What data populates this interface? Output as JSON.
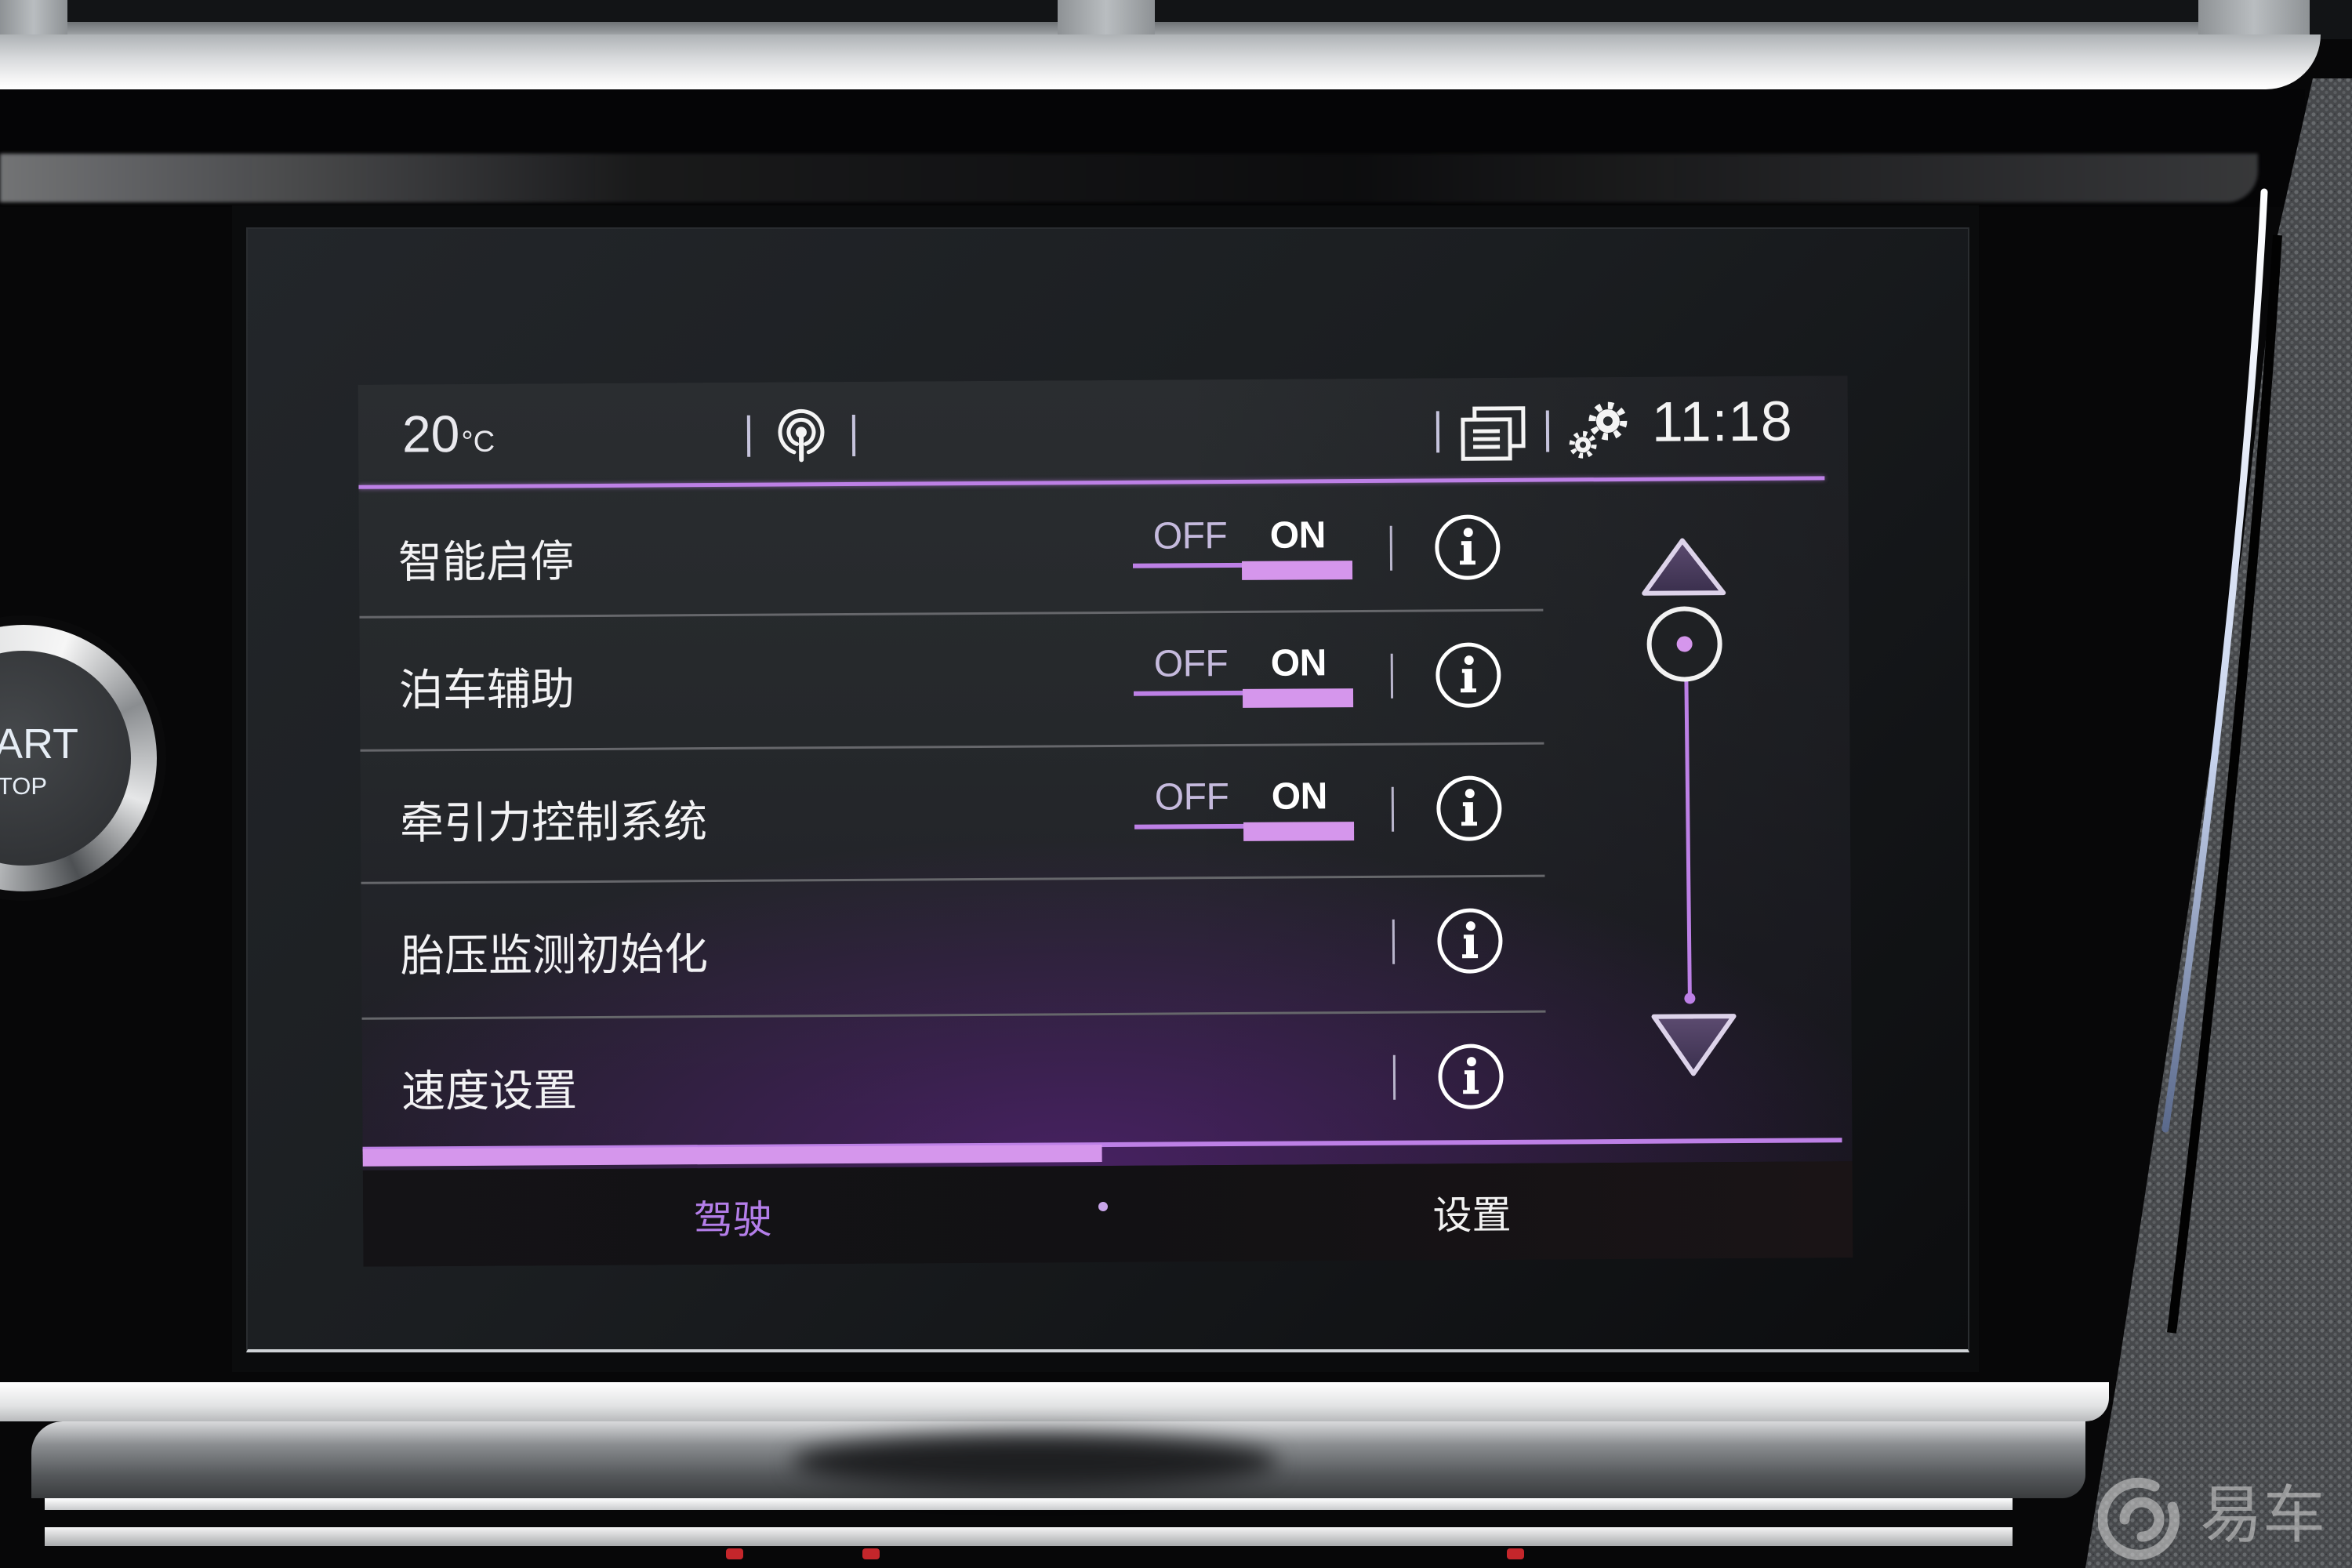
{
  "status_bar": {
    "temperature_value": "20",
    "temperature_unit": "°C",
    "time": "11:18",
    "icons": {
      "connectivity": "antenna-icon",
      "screens": "screen-list-icon",
      "settings": "gears-icon"
    }
  },
  "settings_rows": [
    {
      "label": "智能启停",
      "toggle": {
        "off_label": "OFF",
        "on_label": "ON",
        "value": "ON"
      },
      "info_icon": "info-icon"
    },
    {
      "label": "泊车辅助",
      "toggle": {
        "off_label": "OFF",
        "on_label": "ON",
        "value": "ON"
      },
      "info_icon": "info-icon"
    },
    {
      "label": "牵引力控制系统",
      "toggle": {
        "off_label": "OFF",
        "on_label": "ON",
        "value": "ON"
      },
      "info_icon": "info-icon"
    },
    {
      "label": "胎压监测初始化",
      "toggle": null,
      "info_icon": "info-icon"
    },
    {
      "label": "速度设置",
      "toggle": null,
      "info_icon": "info-icon"
    }
  ],
  "scrollbar": {
    "position": 0,
    "up_icon": "triangle-up-icon",
    "down_icon": "triangle-down-icon"
  },
  "tabs": [
    {
      "label": "驾驶",
      "active": true
    },
    {
      "label": "设置",
      "active": false
    }
  ],
  "colors": {
    "accent": "#bd80e6",
    "accent_bright": "#d596ec",
    "text": "#f2f2f4",
    "toggle_off_text": "#c5badd",
    "separator": "#66676b",
    "ui_background": "#2a2d30",
    "tab_active_text": "#b47ee9"
  },
  "hardware": {
    "start_stop_button": {
      "line1": "ART",
      "line2": "TOP"
    }
  },
  "watermark": {
    "text": "易车"
  }
}
